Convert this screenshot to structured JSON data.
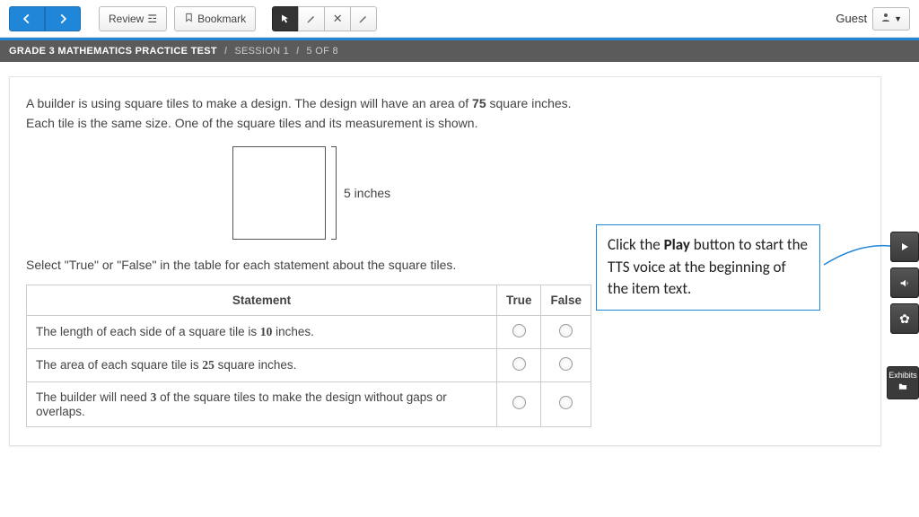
{
  "toolbar": {
    "review_label": "Review",
    "bookmark_label": "Bookmark",
    "user_label": "Guest"
  },
  "breadcrumb": {
    "test": "GRADE 3 MATHEMATICS PRACTICE TEST",
    "session": "SESSION 1",
    "position": "5 OF 8"
  },
  "question": {
    "stem_a": "A builder is using square tiles to make a design. The design will have an area of ",
    "stem_area": "75",
    "stem_b": " square inches. Each tile is the same size. One of the square tiles and its measurement is shown.",
    "dim_label": "5 inches",
    "instruction": "Select \"True\" or \"False\" in the table for each statement about the square tiles."
  },
  "table": {
    "col_statement": "Statement",
    "col_true": "True",
    "col_false": "False",
    "rows": [
      {
        "pre": "The length of each side of a square tile is ",
        "num": "10",
        "post": " inches."
      },
      {
        "pre": "The area of each square tile is ",
        "num": "25",
        "post": " square inches."
      },
      {
        "pre": "The builder will need ",
        "num": "3",
        "post": " of the square tiles to make the design without gaps or overlaps."
      }
    ]
  },
  "callout": {
    "pre": "Click the ",
    "bold": "Play",
    "post": " button to start the TTS voice at the beginning of the item text."
  },
  "side": {
    "exhibits_label": "Exhibits"
  }
}
